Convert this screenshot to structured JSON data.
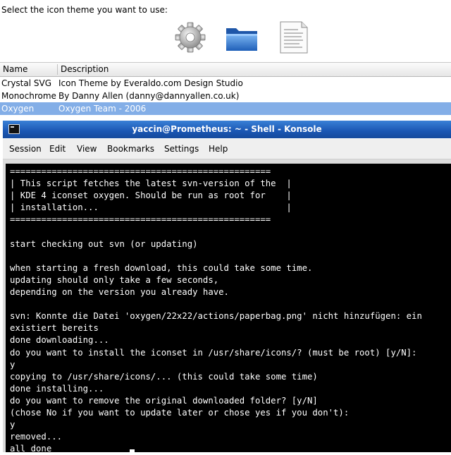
{
  "prompt": "Select the icon theme you want to use:",
  "preview_icons": [
    "gear-icon",
    "folder-icon",
    "document-icon"
  ],
  "columns": [
    "Name",
    "Description"
  ],
  "themes": [
    {
      "name": "Crystal SVG",
      "description": "Icon Theme by Everaldo.com Design Studio",
      "selected": false
    },
    {
      "name": "Monochrome",
      "description": "By Danny Allen (danny@dannyallen.co.uk)",
      "selected": false
    },
    {
      "name": "Oxygen",
      "description": "Oxygen Team - 2006",
      "selected": true
    }
  ],
  "konsole": {
    "title": "yaccin@Prometheus: ~ - Shell - Konsole",
    "menu": [
      "Session",
      "Edit",
      "View",
      "Bookmarks",
      "Settings",
      "Help"
    ],
    "lines": [
      "==================================================",
      "| This script fetches the latest svn-version of the  |",
      "| KDE 4 iconset oxygen. Should be run as root for    |",
      "| installation...                                    |",
      "==================================================",
      "",
      "start checking out svn (or updating)",
      "",
      "when starting a fresh download, this could take some time.",
      "updating should only take a few seconds,",
      "depending on the version you already have.",
      "",
      "svn: Konnte die Datei 'oxygen/22x22/actions/paperbag.png' nicht hinzufügen: ein",
      "existiert bereits",
      "done downloading...",
      "do you want to install the iconset in /usr/share/icons/? (must be root) [y/N]:",
      "y",
      "copying to /usr/share/icons/... (this could take some time)",
      "done installing...",
      "do you want to remove the original downloaded folder? [y/N]",
      "(chose No if you want to update later or chose yes if you don't):",
      "y",
      "removed...",
      "all done"
    ]
  }
}
